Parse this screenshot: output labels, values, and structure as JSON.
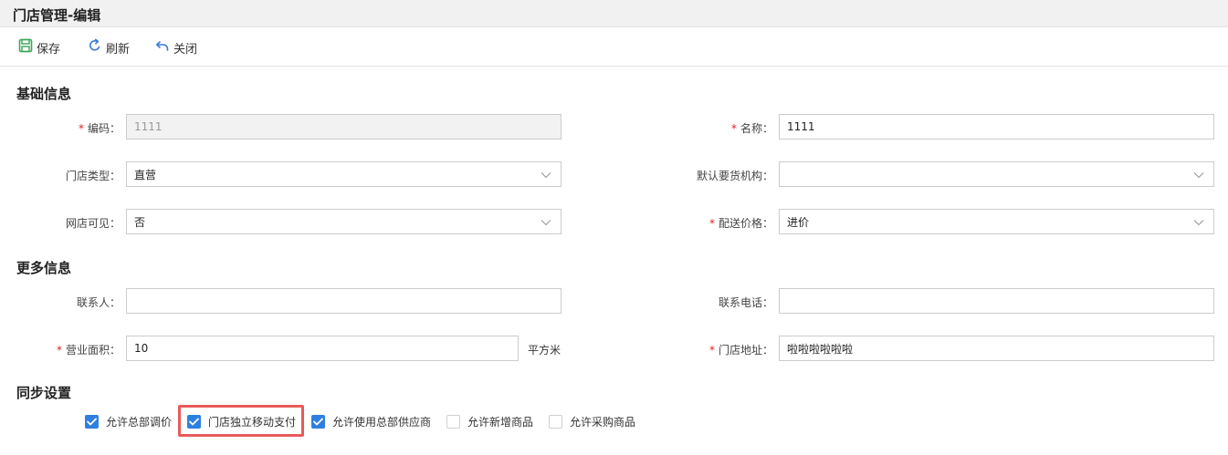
{
  "window": {
    "title": "门店管理-编辑"
  },
  "toolbar": {
    "save_label": "保存",
    "refresh_label": "刷新",
    "close_label": "关闭"
  },
  "sections": {
    "basic": "基础信息",
    "more": "更多信息",
    "sync": "同步设置"
  },
  "basic": {
    "code": {
      "label": "编码：",
      "value": "1111",
      "required": true,
      "disabled": true
    },
    "name": {
      "label": "名称：",
      "value": "1111",
      "required": true
    },
    "store_type": {
      "label": "门店类型：",
      "value": "直营"
    },
    "default_org": {
      "label": "默认要货机构：",
      "value": ""
    },
    "online_visible": {
      "label": "网店可见：",
      "value": "否"
    },
    "delivery_price": {
      "label": "配送价格：",
      "value": "进价",
      "required": true
    }
  },
  "more": {
    "contact": {
      "label": "联系人：",
      "value": ""
    },
    "phone": {
      "label": "联系电话：",
      "value": ""
    },
    "area": {
      "label": "营业面积：",
      "value": "10",
      "unit": "平方米",
      "required": true
    },
    "address": {
      "label": "门店地址：",
      "value": "啦啦啦啦啦啦",
      "required": true
    }
  },
  "sync": {
    "items": [
      {
        "label": "允许总部调价",
        "checked": true
      },
      {
        "label": "门店独立移动支付",
        "checked": true
      },
      {
        "label": "允许使用总部供应商",
        "checked": true
      },
      {
        "label": "允许新增商品",
        "checked": false
      },
      {
        "label": "允许采购商品",
        "checked": false
      }
    ]
  },
  "icons": {
    "save": "save-icon",
    "refresh": "refresh-icon",
    "close": "undo-icon",
    "dropdown": "chevron-down-icon",
    "check": "check-icon"
  },
  "colors": {
    "accent": "#2f7fe0",
    "save_icon": "#3aa655",
    "required": "#e02020",
    "highlight": "#e85a5a"
  }
}
